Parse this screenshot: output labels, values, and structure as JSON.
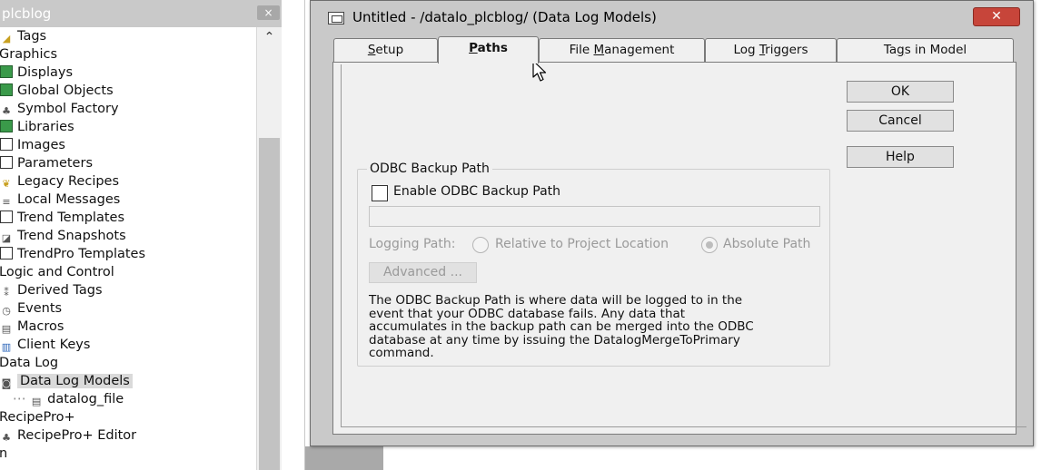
{
  "explorer": {
    "title": "plcblog",
    "close_glyph": "×",
    "items": [
      {
        "label": "Tags",
        "icon": "tag-icon",
        "indent": 0
      },
      {
        "label": "Graphics",
        "icon": "",
        "indent": -1
      },
      {
        "label": "Displays",
        "icon": "display-icon",
        "indent": 0
      },
      {
        "label": "Global Objects",
        "icon": "global-objects-icon",
        "indent": 0
      },
      {
        "label": "Symbol Factory",
        "icon": "symbol-factory-icon",
        "indent": 0
      },
      {
        "label": "Libraries",
        "icon": "library-icon",
        "indent": 0
      },
      {
        "label": "Images",
        "icon": "image-icon",
        "indent": 0
      },
      {
        "label": "Parameters",
        "icon": "parameters-icon",
        "indent": 0
      },
      {
        "label": "Legacy Recipes",
        "icon": "recipe-icon",
        "indent": 0
      },
      {
        "label": "Local Messages",
        "icon": "messages-icon",
        "indent": 0
      },
      {
        "label": "Trend Templates",
        "icon": "trend-template-icon",
        "indent": 0
      },
      {
        "label": "Trend Snapshots",
        "icon": "trend-snapshot-icon",
        "indent": 0
      },
      {
        "label": "TrendPro Templates",
        "icon": "trendpro-icon",
        "indent": 0
      },
      {
        "label": "Logic and Control",
        "icon": "",
        "indent": -1
      },
      {
        "label": "Derived Tags",
        "icon": "derived-tags-icon",
        "indent": 0
      },
      {
        "label": "Events",
        "icon": "events-icon",
        "indent": 0
      },
      {
        "label": "Macros",
        "icon": "macros-icon",
        "indent": 0
      },
      {
        "label": "Client Keys",
        "icon": "client-keys-icon",
        "indent": 0
      },
      {
        "label": "Data Log",
        "icon": "",
        "indent": -1
      },
      {
        "label": "Data Log Models",
        "icon": "data-log-models-icon",
        "indent": 0,
        "selected": true
      },
      {
        "label": "datalog_file",
        "icon": "file-icon",
        "indent": 1
      },
      {
        "label": "RecipePro+",
        "icon": "",
        "indent": -1
      },
      {
        "label": "RecipePro+ Editor",
        "icon": "recipe-editor-icon",
        "indent": 0
      },
      {
        "label": "n",
        "icon": "",
        "indent": -1
      }
    ]
  },
  "dialog": {
    "title": "Untitled - /datalo_plcblog/ (Data Log Models)",
    "close_glyph": "✕",
    "tabs": [
      {
        "label": "Setup",
        "mnemonic_index": 0
      },
      {
        "label": "Paths",
        "mnemonic_index": 0,
        "active": true
      },
      {
        "label": "File Management",
        "mnemonic_index": 5
      },
      {
        "label": "Log Triggers",
        "mnemonic_index": 4
      },
      {
        "label": "Tags in Model",
        "mnemonic_index": 2
      }
    ],
    "buttons": {
      "ok": "OK",
      "cancel": "Cancel",
      "help": "Help"
    },
    "odbc": {
      "group_label": "ODBC Backup Path",
      "enable_label": "Enable ODBC Backup Path",
      "enable_checked": false,
      "path_value": "",
      "logging_path_label": "Logging Path:",
      "relative_label": "Relative to Project Location",
      "absolute_label": "Absolute Path",
      "selected_option": "absolute",
      "advanced_label": "Advanced ...",
      "description_lines": [
        "The ODBC Backup Path is where data will be logged to in the",
        "event that your ODBC database fails.  Any data that",
        "accumulates in the backup path can be merged into the ODBC",
        "database at any time by issuing the DatalogMergeToPrimary",
        "command."
      ]
    }
  },
  "colors": {
    "close_button": "#c7453a",
    "panel": "#f0f0f0",
    "frame": "#c9c9c9"
  }
}
